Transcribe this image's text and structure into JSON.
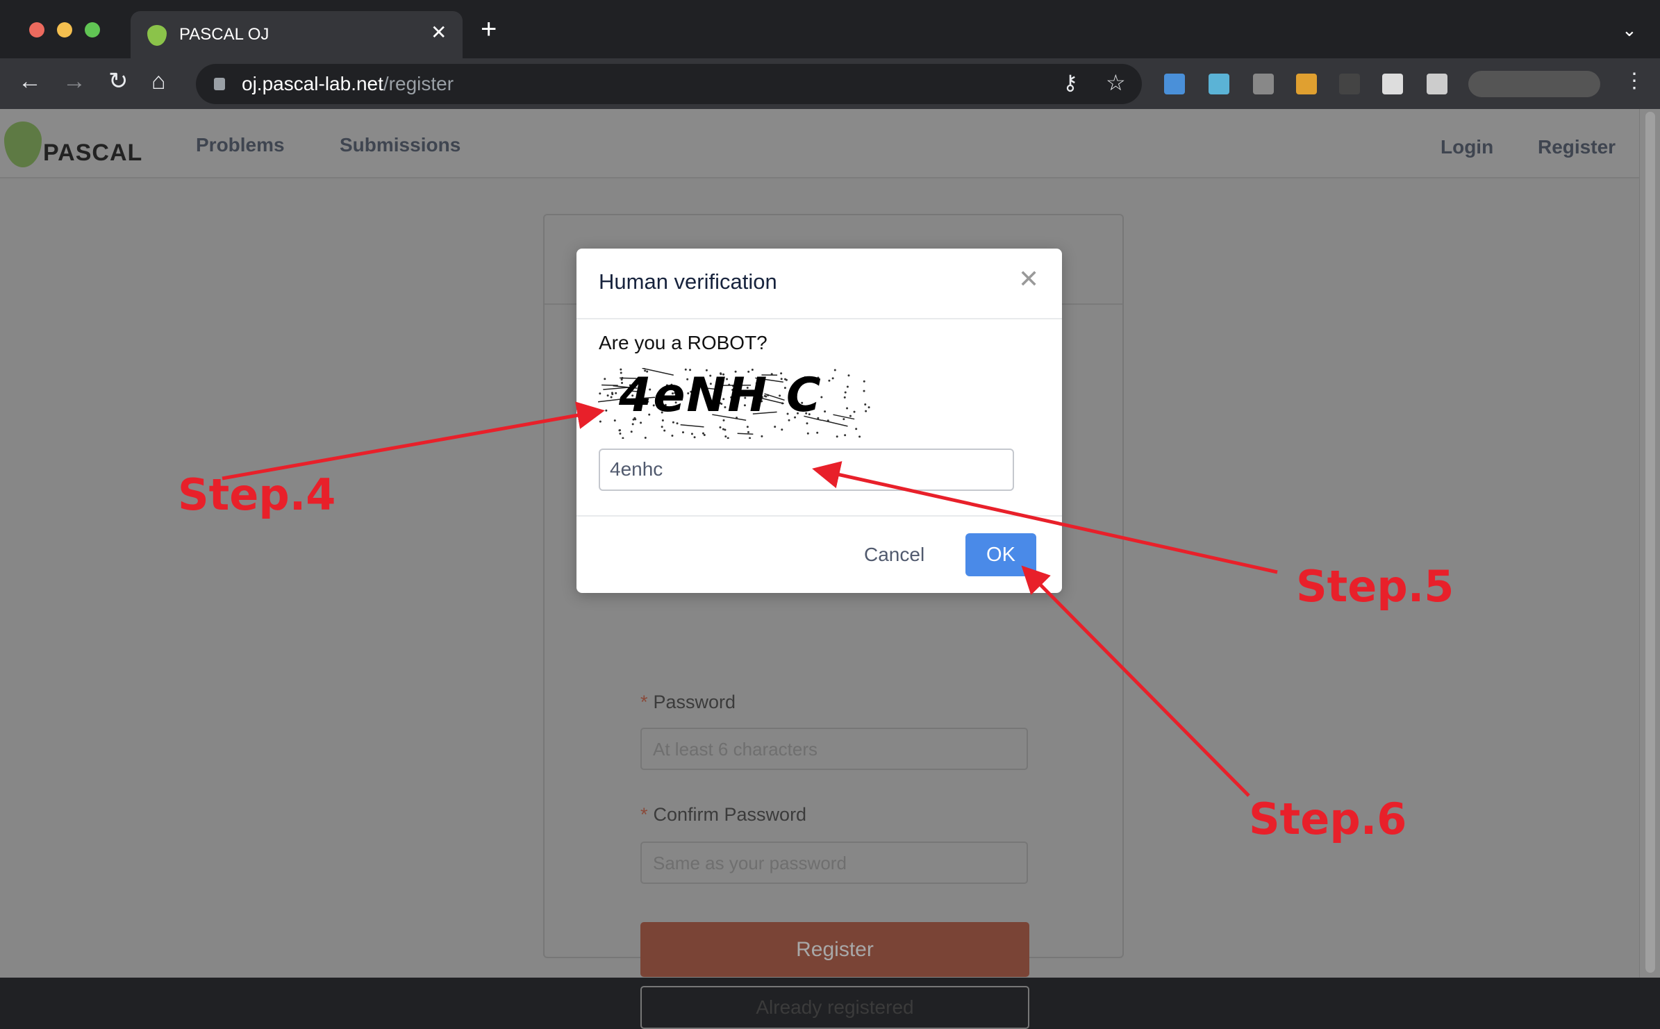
{
  "browser": {
    "tab_title": "PASCAL OJ",
    "url_host": "oj.pascal-lab.net",
    "url_path": "/register"
  },
  "navbar": {
    "logo": "PASCAL",
    "links": [
      "Problems",
      "Submissions"
    ],
    "login": "Login",
    "register": "Register"
  },
  "form": {
    "password_label": "Password",
    "password_placeholder": "At least 6 characters",
    "confirm_label": "Confirm Password",
    "confirm_placeholder": "Same as your password",
    "register_button": "Register",
    "already_button": "Already registered",
    "required_mark": "*"
  },
  "dialog": {
    "title": "Human verification",
    "question": "Are you a ROBOT?",
    "captcha_text": "4eNH C",
    "input_value": "4enhc",
    "cancel": "Cancel",
    "ok": "OK"
  },
  "annotations": {
    "step4": "Step.4",
    "step5": "Step.5",
    "step6": "Step.6",
    "color": "#e8202a"
  },
  "colors": {
    "ok_button": "#4a8ae8",
    "register_button": "#7a4436"
  }
}
